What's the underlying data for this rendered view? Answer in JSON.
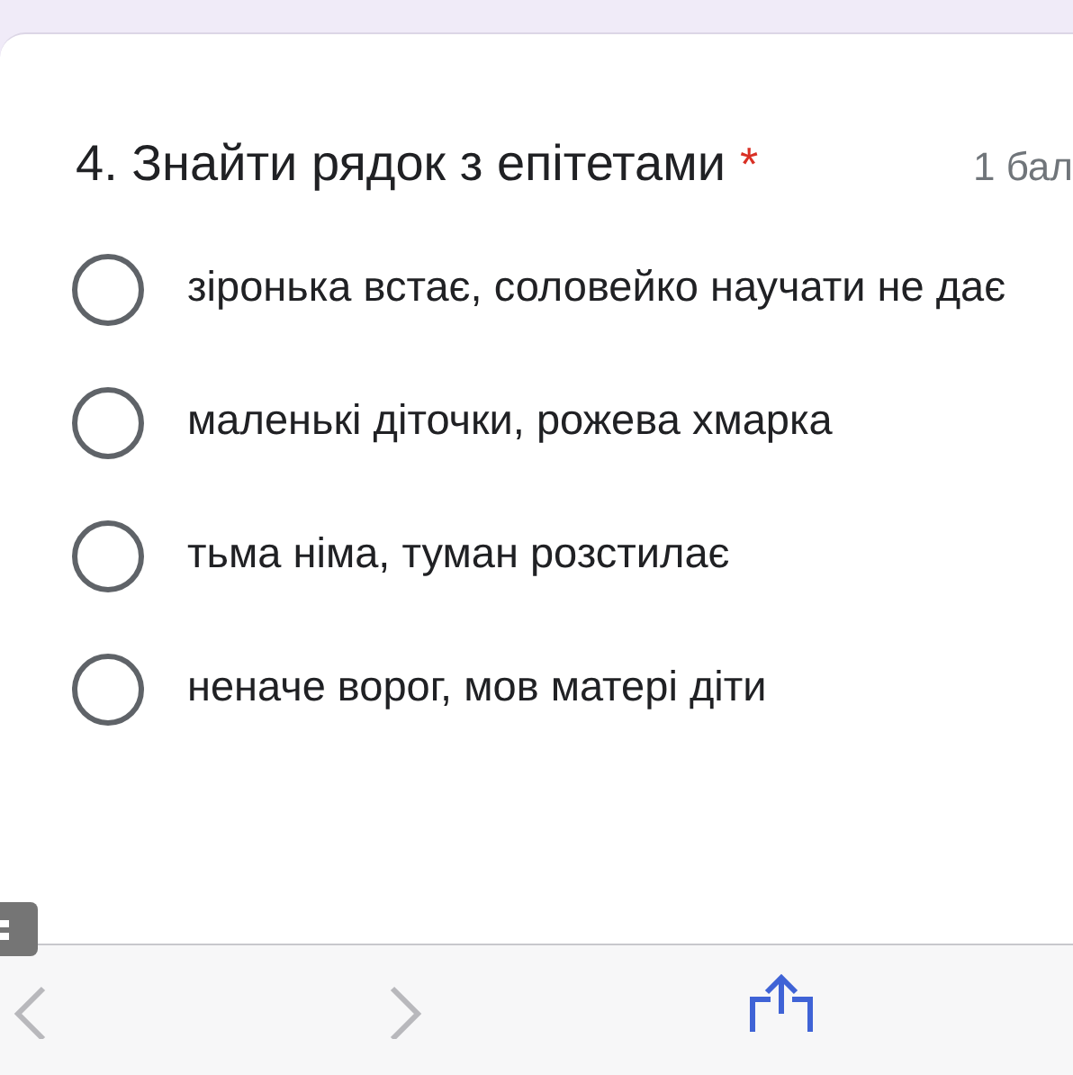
{
  "question": {
    "title": "4. Знайти рядок з епітетами",
    "required_mark": "*",
    "points": "1 бал"
  },
  "options": [
    {
      "label": "зіронька встає, соловейко научати не дає",
      "selected": false
    },
    {
      "label": "маленькі діточки, рожева хмарка",
      "selected": false
    },
    {
      "label": "тьма німа, туман розстилає",
      "selected": false
    },
    {
      "label": "неначе ворог, мов матері діти",
      "selected": false
    }
  ],
  "toolbar": {
    "back_disabled": true,
    "forward_disabled": true
  }
}
